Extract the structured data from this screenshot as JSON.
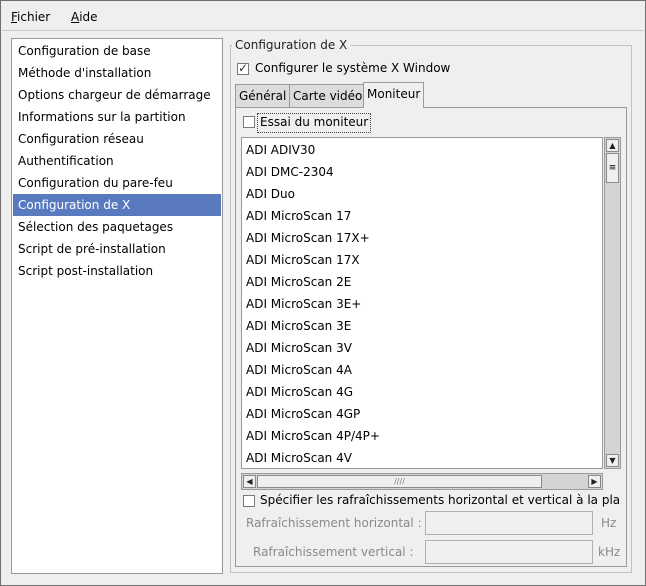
{
  "menubar": {
    "file_accel": "F",
    "file_rest": "ichier",
    "help_accel": "A",
    "help_rest": "ide"
  },
  "sidebar": {
    "items": [
      {
        "label": "Configuration de base"
      },
      {
        "label": "Méthode d'installation"
      },
      {
        "label": "Options chargeur de démarrage"
      },
      {
        "label": "Informations sur la partition"
      },
      {
        "label": "Configuration réseau"
      },
      {
        "label": "Authentification"
      },
      {
        "label": "Configuration du pare-feu"
      },
      {
        "label": "Configuration de X"
      },
      {
        "label": "Sélection des paquetages"
      },
      {
        "label": "Script de pré-installation"
      },
      {
        "label": "Script post-installation"
      }
    ],
    "selected_index": 7
  },
  "panel": {
    "frame_title": "Configuration de X",
    "configure_x_label": "Configurer le système X Window",
    "configure_x_checked": true,
    "tabs": [
      {
        "label": "Général"
      },
      {
        "label": "Carte vidéo"
      },
      {
        "label": "Moniteur"
      }
    ],
    "active_tab": "Moniteur",
    "probe_monitor_label": "Essai du moniteur",
    "probe_monitor_checked": false,
    "monitors": [
      "ADI ADIV30",
      "ADI DMC-2304",
      "ADI Duo",
      "ADI MicroScan 17",
      "ADI MicroScan 17X+",
      "ADI MicroScan 17X",
      "ADI MicroScan 2E",
      "ADI MicroScan 3E+",
      "ADI MicroScan 3E",
      "ADI MicroScan 3V",
      "ADI MicroScan 4A",
      "ADI MicroScan 4G",
      "ADI MicroScan 4GP",
      "ADI MicroScan 4P/4P+",
      "ADI MicroScan 4V"
    ],
    "sync_label": "Spécifier les rafraîchissements horizontal et vertical à la place",
    "sync_checked": false,
    "hsync_label": "Rafraîchissement horizontal :",
    "hsync_value": "",
    "hsync_unit": "Hz",
    "vsync_label": "Rafraîchissement vertical :",
    "vsync_value": "",
    "vsync_unit": "kHz"
  },
  "icons": {
    "check": "✓",
    "arrow_up": "▲",
    "arrow_down": "▼",
    "arrow_left": "◀",
    "arrow_right": "▶",
    "grip_h": "////",
    "grip_v": "≡"
  },
  "colors": {
    "selection": "#5a7abf",
    "background": "#efefef"
  }
}
